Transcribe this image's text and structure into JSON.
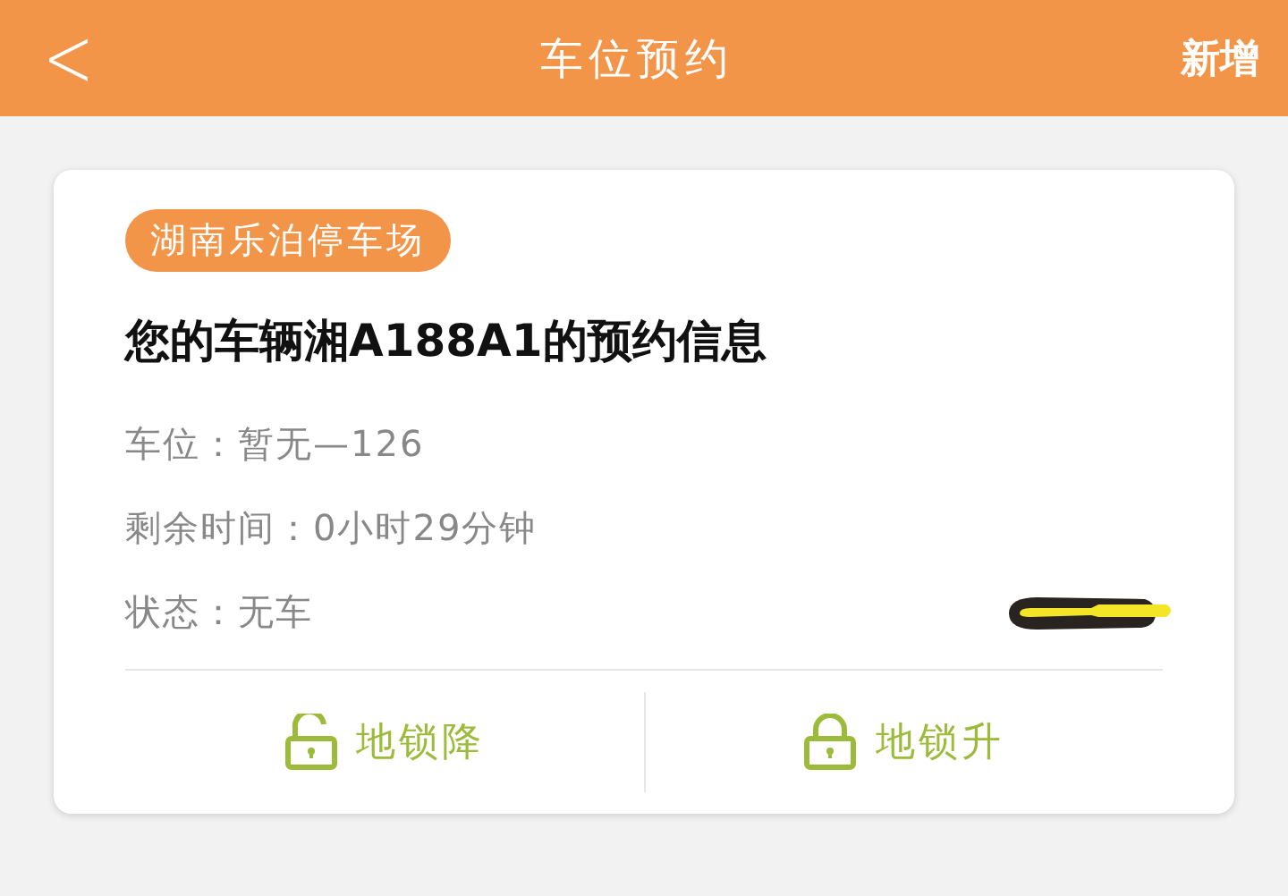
{
  "header": {
    "back": "<",
    "title": "车位预约",
    "action": "新增"
  },
  "card": {
    "parking_lot": "湖南乐泊停车场",
    "heading": "您的车辆湘A188A1的预约信息",
    "details": [
      {
        "label": "车位：",
        "value": "暂无—126"
      },
      {
        "label": "剩余时间：",
        "value": "0小时29分钟"
      },
      {
        "label": "状态：",
        "value": "无车"
      }
    ],
    "buttons": [
      {
        "label": "地锁降",
        "kind": "unlocked"
      },
      {
        "label": "地锁升",
        "kind": "locked"
      }
    ]
  }
}
